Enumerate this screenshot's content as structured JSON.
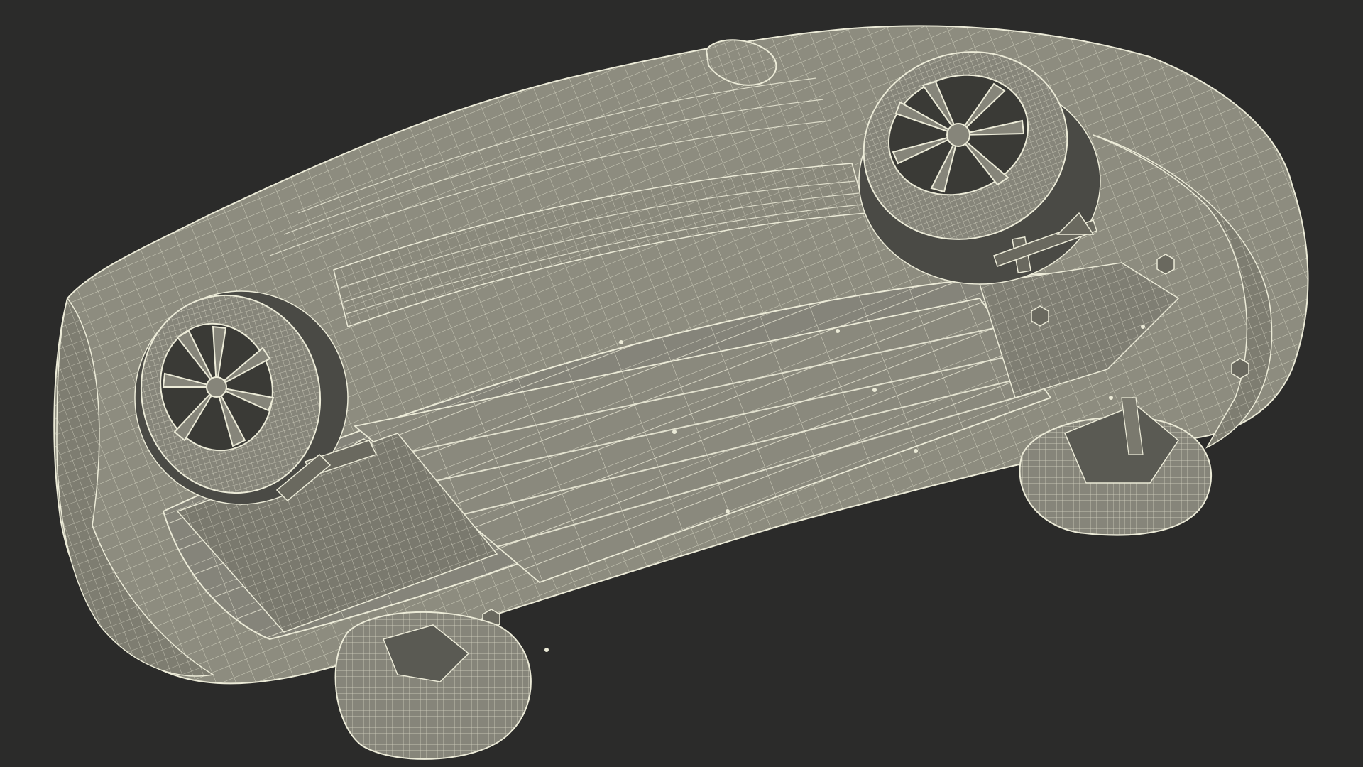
{
  "scene": {
    "subject": "car-underside-wireframe",
    "view": "bottom",
    "colors": {
      "background": "#2b2b2a",
      "surface": "#8d8c7f",
      "surface_dark": "#6f6e63",
      "surface_light": "#a3a294",
      "wire": "#ecebd8",
      "wire_dim": "#c9c8b6",
      "tire": "#86857a",
      "rim_dark": "#3a3a36"
    }
  }
}
